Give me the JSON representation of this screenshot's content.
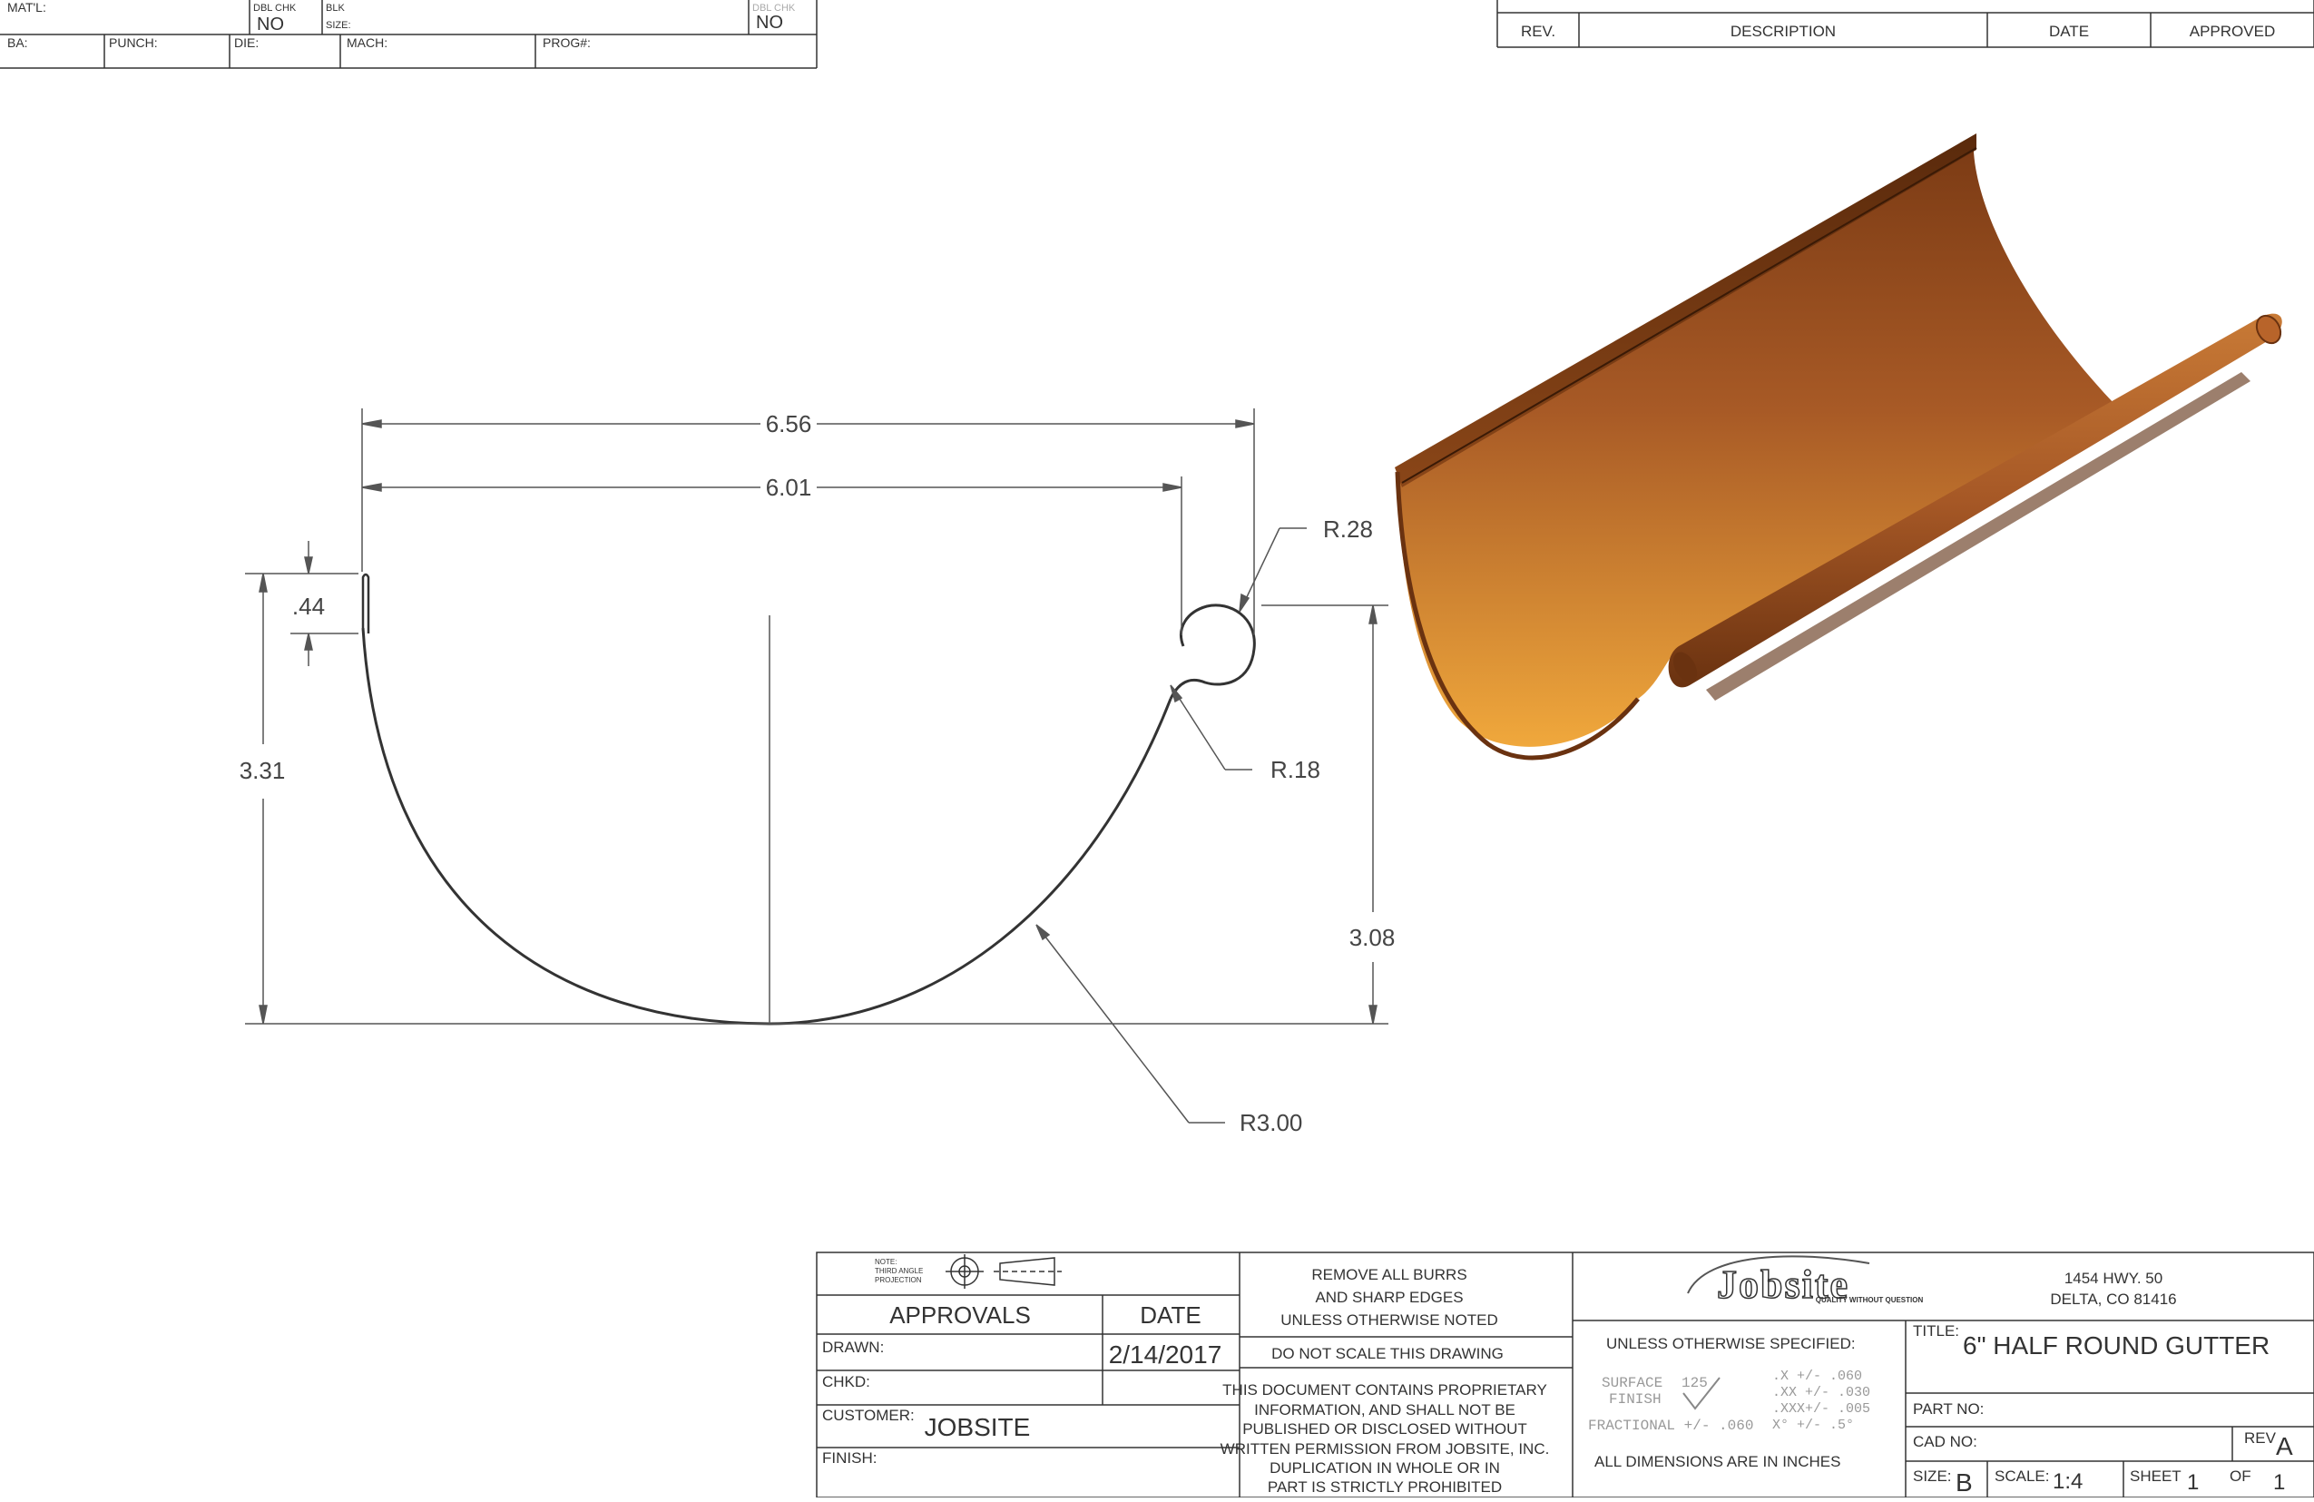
{
  "top_left_block": {
    "matl_label": "MAT'L:",
    "dbl_chk_label": "DBL CHK",
    "dbl_chk_value": "NO",
    "blk_size_label1": "BLK",
    "blk_size_label2": "SIZE:",
    "dbl_chk2_label": "DBL CHK",
    "dbl_chk2_value": "NO",
    "ba_label": "BA:",
    "punch_label": "PUNCH:",
    "die_label": "DIE:",
    "mach_label": "MACH:",
    "prog_label": "PROG#:"
  },
  "revision_block": {
    "rev_label": "REV.",
    "description_label": "DESCRIPTION",
    "date_label": "DATE",
    "approved_label": "APPROVED"
  },
  "dimensions": {
    "overall_width": "6.56",
    "inner_width": "6.01",
    "bead_radius": "R.28",
    "hem_height": ".44",
    "back_height": "3.31",
    "neck_radius": "R.18",
    "front_height": "3.08",
    "trough_radius": "R3.00"
  },
  "title_block": {
    "projection_note1": "NOTE:",
    "projection_note2": "THIRD ANGLE",
    "projection_note3": "PROJECTION",
    "approvals_label": "APPROVALS",
    "date_col_label": "DATE",
    "drawn_label": "DRAWN:",
    "drawn_date": "2/14/2017",
    "chkd_label": "CHKD:",
    "customer_label": "CUSTOMER:",
    "customer_value": "JOBSITE",
    "finish_label": "FINISH:",
    "burrs_line1": "REMOVE ALL BURRS",
    "burrs_line2": "AND SHARP EDGES",
    "burrs_line3": "UNLESS OTHERWISE NOTED",
    "no_scale": "DO NOT SCALE THIS DRAWING",
    "prop_line1": "THIS DOCUMENT CONTAINS PROPRIETARY",
    "prop_line2": "INFORMATION, AND SHALL NOT BE",
    "prop_line3": "PUBLISHED OR DISCLOSED WITHOUT",
    "prop_line4": "WRITTEN PERMISSION FROM JOBSITE, INC.",
    "prop_line5": "DUPLICATION IN WHOLE OR IN",
    "prop_line6": "PART IS STRICTLY PROHIBITED",
    "logo_text": "Jobsite",
    "logo_tagline": "QUALITY WITHOUT QUESTION",
    "unless_specified": "UNLESS OTHERWISE SPECIFIED:",
    "surface_label1": "SURFACE",
    "surface_label2": "FINISH",
    "surface_value": "125",
    "tol_x": ".X   +/- .060",
    "tol_xx": ".XX  +/- .030",
    "tol_xxx": ".XXX+/- .005",
    "tol_ang": "X°   +/- .5°",
    "fractional": "FRACTIONAL +/- .060",
    "all_dims": "ALL DIMENSIONS ARE IN INCHES",
    "address1": "1454 HWY. 50",
    "address2": "DELTA, CO 81416",
    "title_label": "TITLE:",
    "title_value": "6\" HALF ROUND GUTTER",
    "part_no_label": "PART NO:",
    "cad_no_label": "CAD NO:",
    "rev_label": "REV",
    "rev_value": "A",
    "size_label": "SIZE:",
    "size_value": "B",
    "scale_label": "SCALE:",
    "scale_value": "1:4",
    "sheet_label": "SHEET",
    "sheet_value": "1",
    "of_label": "OF",
    "of_value": "1"
  },
  "colors": {
    "line": "#333333",
    "dim_line": "#555555",
    "copper_dark": "#7a3a14",
    "copper_mid": "#b8642a",
    "copper_light": "#f0a83c"
  }
}
